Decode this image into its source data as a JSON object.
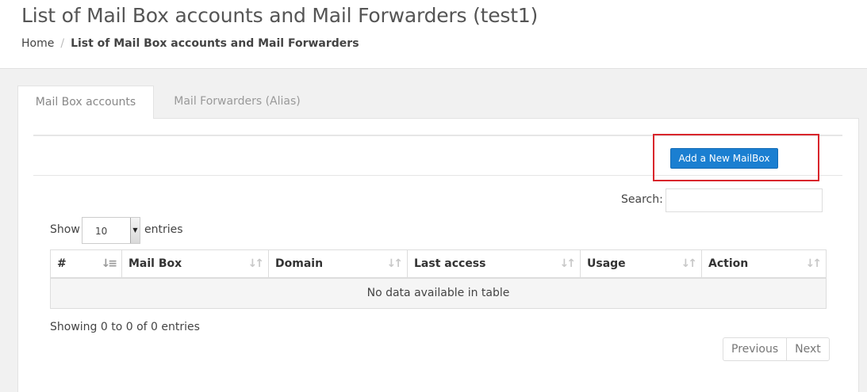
{
  "page": {
    "title": "List of Mail Box accounts and Mail Forwarders (test1)"
  },
  "breadcrumb": {
    "home": "Home",
    "separator": "/",
    "current": "List of Mail Box accounts and Mail Forwarders"
  },
  "tabs": [
    {
      "label": "Mail Box accounts",
      "active": true
    },
    {
      "label": "Mail Forwarders (Alias)",
      "active": false
    }
  ],
  "toolbar": {
    "add_label": "Add a New MailBox"
  },
  "search": {
    "label": "Search:",
    "value": ""
  },
  "length": {
    "show": "Show",
    "value": "10",
    "entries": "entries"
  },
  "table": {
    "columns": [
      "#",
      "Mail Box",
      "Domain",
      "Last access",
      "Usage",
      "Action"
    ],
    "empty": "No data available in table"
  },
  "info": "Showing 0 to 0 of 0 entries",
  "pagination": {
    "previous": "Previous",
    "next": "Next"
  },
  "colors": {
    "accent": "#1b7fd1",
    "highlight": "#d9262c"
  },
  "icons": {
    "sort_active": "sort-asc-icon",
    "sort": "sort-both-icon",
    "dropdown": "caret-down-icon"
  }
}
